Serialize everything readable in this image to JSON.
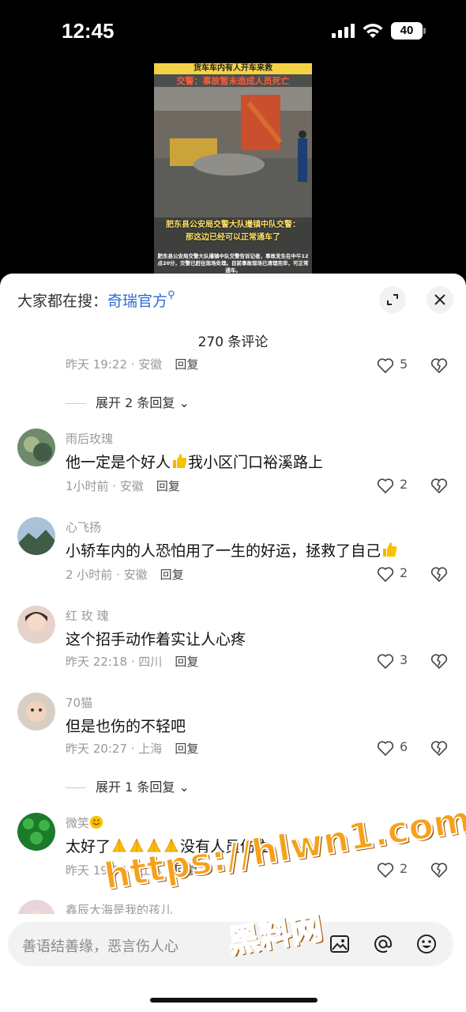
{
  "status_bar": {
    "time": "12:45",
    "battery": "40"
  },
  "video": {
    "banner_title": "货车车内有人开车来救",
    "subtitle": "交警：事故暂未造成人员死亡",
    "caption_line1": "肥东县公安局交警大队撮镇中队交警：",
    "caption_line2": "那这边已经可以正常通车了",
    "small_text": "肥东县公安局交警大队撮镇中队交警告诉记者，事故发生在中午12点20分，交警已赶往现场处理。目前事故现场已清理完毕，可正常通车。"
  },
  "sheet": {
    "search_prefix": "大家都在搜：",
    "search_keyword": "奇瑞官方",
    "comment_count": "270 条评论"
  },
  "comments": [
    {
      "meta": "昨天 19:22 · 安徽",
      "reply": "回复",
      "likes": "5"
    },
    {
      "expand": "展开 2 条回复"
    },
    {
      "name": "雨后玫瑰",
      "text_a": "他一定是个好人",
      "text_b": "我小区门口裕溪路上",
      "meta": "1小时前 · 安徽",
      "reply": "回复",
      "likes": "2"
    },
    {
      "name": "心飞扬",
      "text_a": "小轿车内的人恐怕用了一生的好运，拯救了自己",
      "meta": "2 小时前 · 安徽",
      "reply": "回复",
      "likes": "2"
    },
    {
      "name": "红 玫 瑰",
      "text_a": "这个招手动作着实让人心疼",
      "meta": "昨天 22:18 · 四川",
      "reply": "回复",
      "likes": "3"
    },
    {
      "name": "70猫",
      "text_a": "但是也伤的不轻吧",
      "meta": "昨天 20:27 · 上海",
      "reply": "回复",
      "likes": "6"
    },
    {
      "expand": "展开 1 条回复"
    },
    {
      "name": "微笑",
      "text_a": "太好了",
      "text_b": "没有人员伤亡",
      "meta": "昨天 19:33 · 江苏",
      "reply": "回复",
      "likes": "2"
    },
    {
      "name": "鑫辰大海是我的孩儿"
    }
  ],
  "input": {
    "placeholder": "善语结善缘，恶言伤人心"
  },
  "watermark": {
    "url": "https://hlwn1.com",
    "name": "黑料网"
  },
  "icons": {
    "status": [
      "signal-icon",
      "wifi-icon",
      "battery-icon"
    ],
    "sheet": [
      "expand-icon",
      "close-icon",
      "search-icon",
      "heart-icon",
      "broken-heart-icon",
      "chevron-down-icon"
    ],
    "input": [
      "image-icon",
      "at-icon",
      "emoji-icon"
    ]
  },
  "colors": {
    "keyword": "#2c6ad6",
    "watermark": "#f6a11a"
  }
}
